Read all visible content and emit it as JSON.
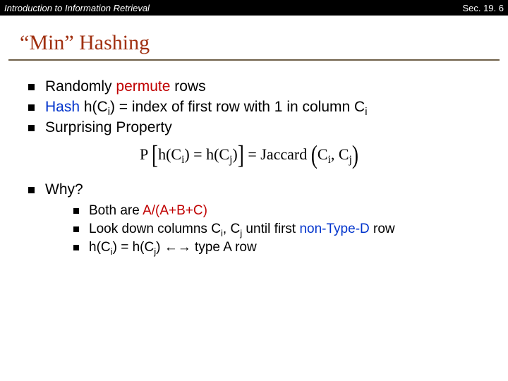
{
  "topbar": {
    "left": "Introduction to Information Retrieval",
    "right": "Sec. 19. 6"
  },
  "title": "“Min” Hashing",
  "bullets": {
    "b1a": "Randomly ",
    "b1b": "permute",
    "b1c": " rows",
    "b2a": "Hash",
    "b2b": " h(C",
    "b2c": ") = index of first row with 1 in column C",
    "b3": "Surprising Property",
    "b4": "Why?"
  },
  "sub_i": "i",
  "sub_j": "j",
  "formula": {
    "p": "P",
    "lb": "[",
    "mid1": "h(C",
    "eq": ") = h(C",
    "mid2": ")",
    "rb": "]",
    "eqs": "= Jaccard",
    "lp": "(",
    "c": "C",
    "comma": ", C",
    "rp": ")"
  },
  "subs": {
    "s1a": "Both are ",
    "s1b": "A/(A+B+C)",
    "s2a": "Look down columns C",
    "s2b": ", C",
    "s2c": " until first ",
    "s2d": "non-Type-D",
    "s2e": " row",
    "s3a": "h(C",
    "s3b": ") = h(C",
    "s3c": ") ←→ type A row"
  }
}
